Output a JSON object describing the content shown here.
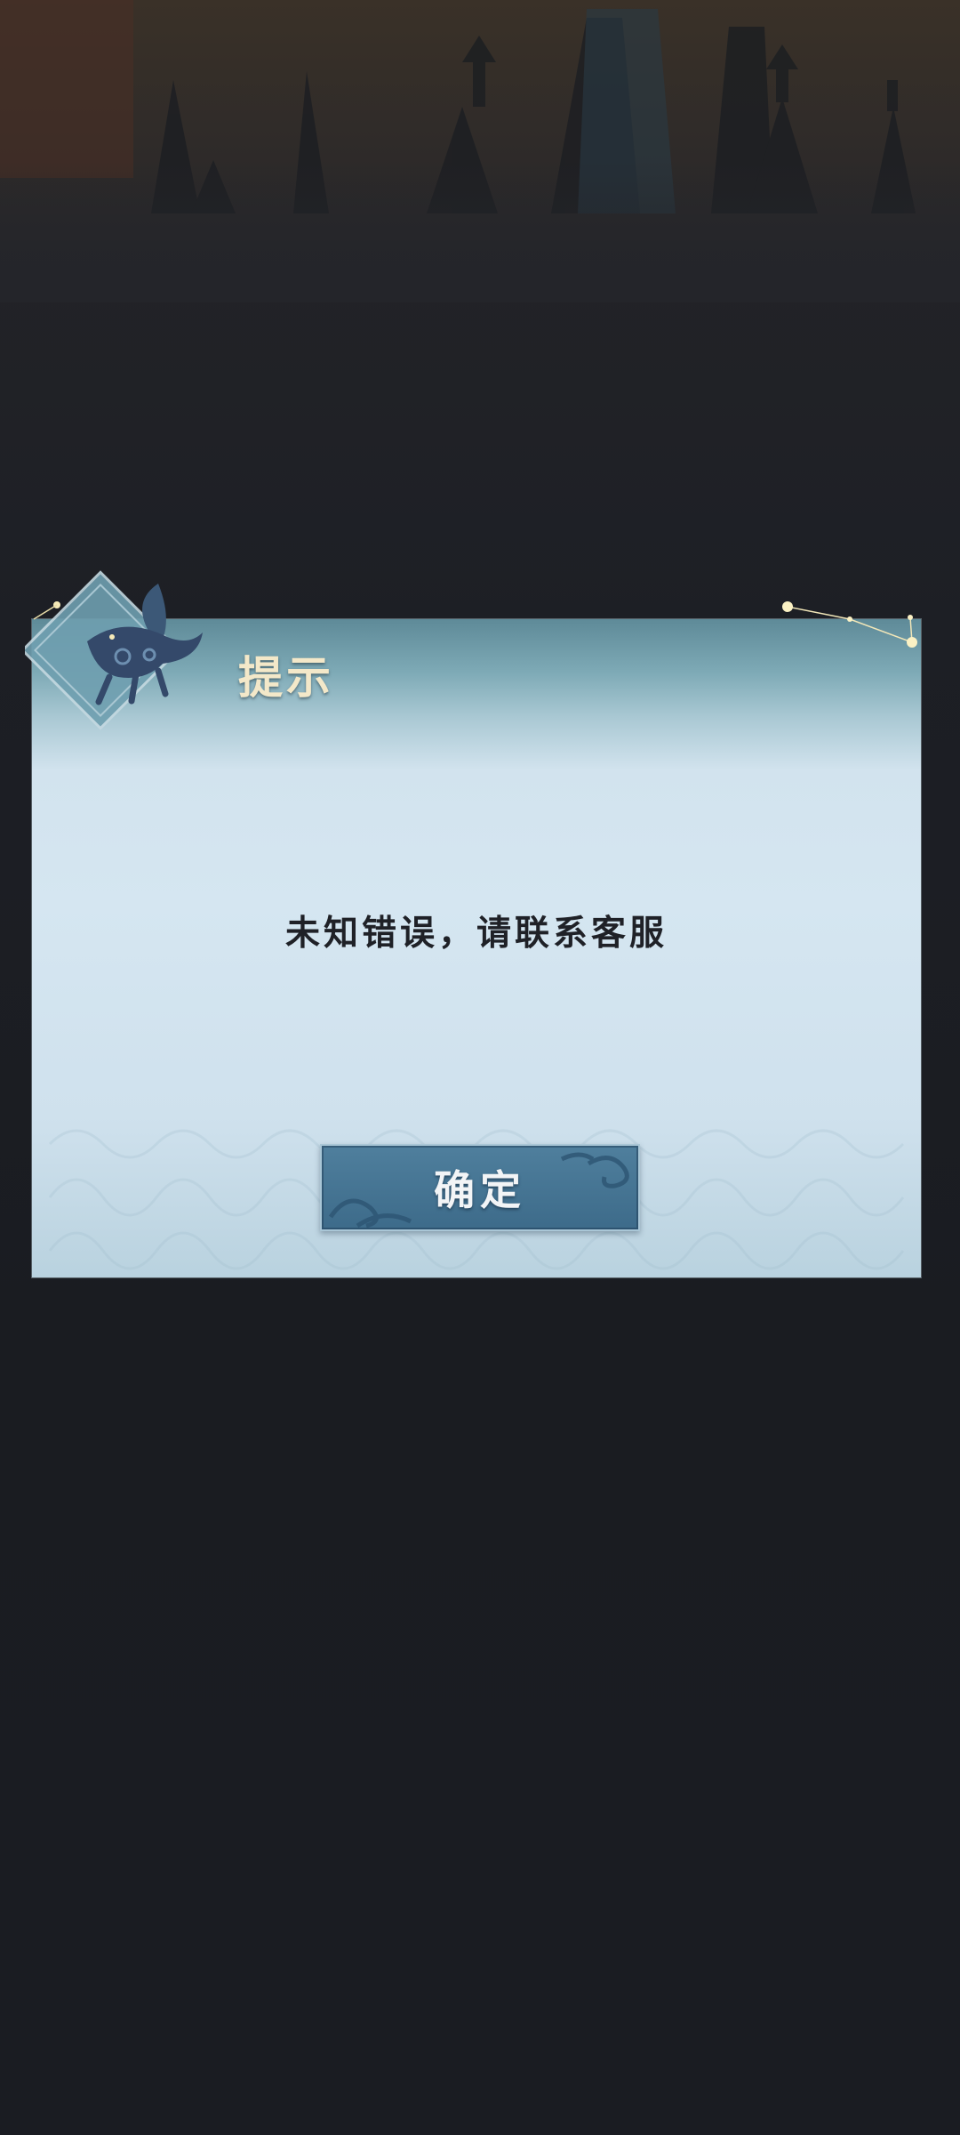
{
  "dialog": {
    "title": "提示",
    "message": "未知错误，请联系客服",
    "confirm_label": "确定"
  },
  "colors": {
    "title_text": "#f3e8c9",
    "button_fill": "#4a7a99",
    "background": "#1b1d22"
  },
  "icons": {
    "title_emblem": "mythical-beast-icon",
    "corner_stars": "constellation-icon"
  }
}
